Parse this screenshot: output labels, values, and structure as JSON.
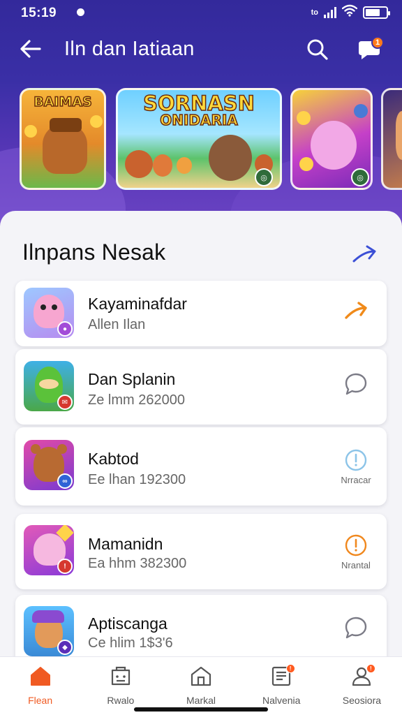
{
  "status_bar": {
    "time": "15:19",
    "network": "to",
    "battery_level": 0.72
  },
  "header": {
    "title": "Iln dan Iatiaan",
    "notification_count": "1"
  },
  "banners": [
    {
      "title": "BAIMAS"
    },
    {
      "title": "SORNASN",
      "subtitle": "ONIDARIA"
    },
    {
      "title": ""
    },
    {
      "title": ""
    }
  ],
  "section": {
    "title": "Ilnpans Nesak"
  },
  "apps": [
    {
      "name": "Kayaminafdar",
      "meta": "Allen Ilan",
      "action_label": "",
      "action_icon": "arrow-icon",
      "mini_color": "#a24bd8"
    },
    {
      "name": "Dan Splanin",
      "meta": "Ze lmm 262000",
      "action_label": "",
      "action_icon": "chat-bubble-icon",
      "mini_color": "#d6382f"
    },
    {
      "name": "Kabtod",
      "meta": "Ee lhan 192300",
      "action_label": "Nrracar",
      "action_icon": "info-icon",
      "mini_color": "#2f63d6"
    },
    {
      "name": "Mamanidn",
      "meta": "Ea hhm 382300",
      "action_label": "Nrantal",
      "action_icon": "alert-icon",
      "mini_color": "#d6382f"
    },
    {
      "name": "Aptiscanga",
      "meta": "Ce hlim 1$3'6",
      "action_label": "",
      "action_icon": "chat-bubble-icon",
      "mini_color": "#5a2fb8"
    }
  ],
  "nav": [
    {
      "label": "Flean",
      "icon": "home-icon",
      "active": true,
      "badge": ""
    },
    {
      "label": "Rwalo",
      "icon": "store-icon",
      "active": false,
      "badge": ""
    },
    {
      "label": "Markal",
      "icon": "market-icon",
      "active": false,
      "badge": ""
    },
    {
      "label": "Nalvenia",
      "icon": "news-icon",
      "active": false,
      "badge": "!"
    },
    {
      "label": "Seosiora",
      "icon": "profile-icon",
      "active": false,
      "badge": "!"
    }
  ],
  "colors": {
    "brand_purple": "#3a2fa6",
    "accent_orange": "#f05a22",
    "arrow_blue": "#3b4fd6"
  }
}
